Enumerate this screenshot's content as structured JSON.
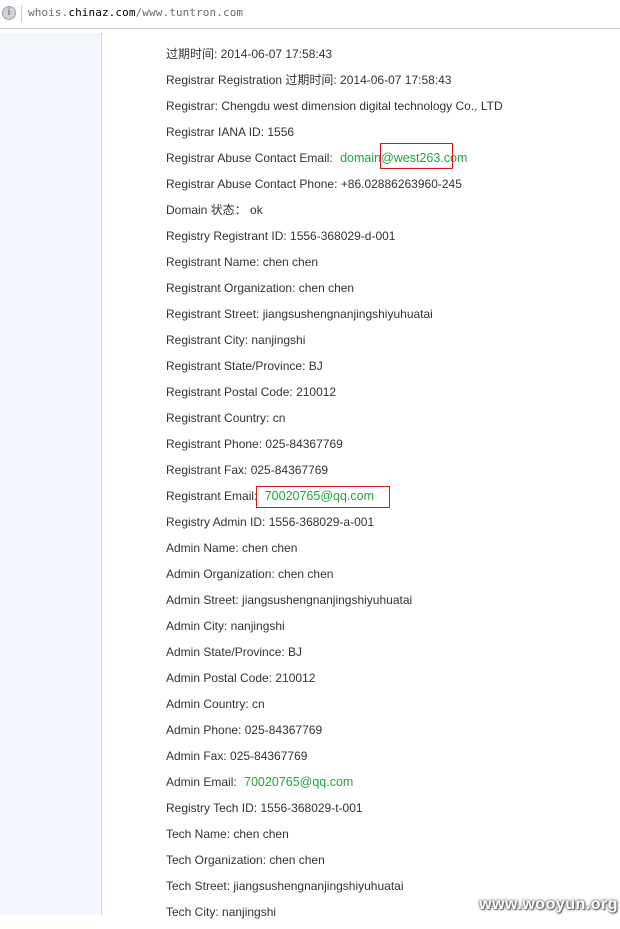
{
  "browser": {
    "url_prefix": "whois.",
    "url_host": "chinaz.com",
    "url_path": "/www.tuntron.com",
    "site_icon": "info-circle-icon"
  },
  "whois": {
    "rows": [
      "过期时间: 2014-06-07 17:58:43",
      "Registrar Registration 过期时间: 2014-06-07 17:58:43",
      "Registrar: Chengdu west dimension digital technology Co., LTD",
      "Registrar IANA ID: 1556"
    ],
    "abuse_email_label": "Registrar Abuse Contact Email:",
    "abuse_email": "domain@west263.com",
    "rows2": [
      "Registrar Abuse Contact Phone: +86.02886263960-245",
      "Domain 状态： ok",
      "Registry Registrant ID: 1556-368029-d-001",
      "Registrant Name: chen chen",
      "Registrant Organization: chen chen",
      "Registrant Street: jiangsushengnanjingshiyuhuatai",
      "Registrant City: nanjingshi",
      "Registrant State/Province: BJ",
      "Registrant Postal Code: 210012",
      "Registrant Country: cn",
      "Registrant Phone: 025-84367769",
      "Registrant Fax: 025-84367769"
    ],
    "registrant_email_label": "Registrant Email:",
    "registrant_email": "70020765@qq.com",
    "rows3": [
      "Registry Admin ID: 1556-368029-a-001",
      "Admin Name: chen chen",
      "Admin Organization: chen chen",
      "Admin Street: jiangsushengnanjingshiyuhuatai",
      "Admin City: nanjingshi",
      "Admin State/Province: BJ",
      "Admin Postal Code: 210012",
      "Admin Country: cn",
      "Admin Phone: 025-84367769",
      "Admin Fax: 025-84367769"
    ],
    "admin_email_label": "Admin Email:",
    "admin_email": "70020765@qq.com",
    "rows4": [
      "Registry Tech ID: 1556-368029-t-001",
      "Tech Name: chen chen",
      "Tech Organization: chen chen",
      "Tech Street: jiangsushengnanjingshiyuhuatai",
      "Tech City: nanjingshi"
    ]
  },
  "watermark": "www.wooyun.org",
  "colors": {
    "text": "#333333",
    "email": "#19a83b",
    "highlight_box": "#d81818",
    "sidebar": "#f3f7fd"
  }
}
